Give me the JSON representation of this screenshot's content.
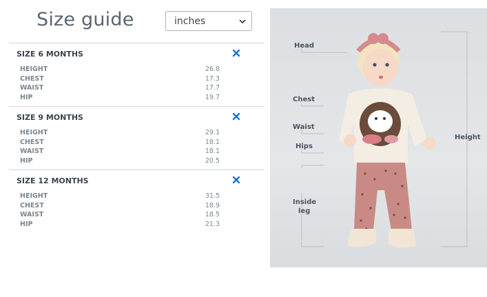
{
  "header": {
    "title": "Size guide"
  },
  "unit_select": {
    "value": "inches",
    "options": [
      "inches"
    ]
  },
  "sizes": [
    {
      "heading": "SIZE 6 MONTHS",
      "rows": [
        {
          "label": "HEIGHT",
          "value": "26.8"
        },
        {
          "label": "CHEST",
          "value": "17.3"
        },
        {
          "label": "WAIST",
          "value": "17.7"
        },
        {
          "label": "HIP",
          "value": "19.7"
        }
      ]
    },
    {
      "heading": "SIZE 9 MONTHS",
      "rows": [
        {
          "label": "HEIGHT",
          "value": "29.1"
        },
        {
          "label": "CHEST",
          "value": "18.1"
        },
        {
          "label": "WAIST",
          "value": "18.1"
        },
        {
          "label": "HIP",
          "value": "20.5"
        }
      ]
    },
    {
      "heading": "SIZE 12 MONTHS",
      "rows": [
        {
          "label": "HEIGHT",
          "value": "31.5"
        },
        {
          "label": "CHEST",
          "value": "18.9"
        },
        {
          "label": "WAIST",
          "value": "18.5"
        },
        {
          "label": "HIP",
          "value": "21.3"
        }
      ]
    }
  ],
  "measure_guide": {
    "head": "Head",
    "chest": "Chest",
    "waist": "Waist",
    "hips": "Hips",
    "inside_leg_1": "Inside",
    "inside_leg_2": "leg",
    "height": "Height"
  },
  "colors": {
    "accent": "#1a73d8",
    "divider": "#cfd4d9",
    "text": "#3b4550"
  }
}
